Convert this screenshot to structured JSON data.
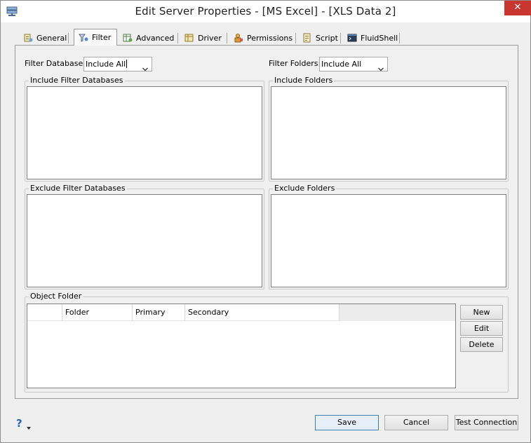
{
  "window": {
    "title": "Edit Server Properties - [MS Excel] - [XLS Data 2]",
    "close_glyph": "✕"
  },
  "tabs": [
    {
      "label": "General",
      "icon": "general-icon"
    },
    {
      "label": "Filter",
      "icon": "filter-icon",
      "active": true
    },
    {
      "label": "Advanced",
      "icon": "advanced-icon"
    },
    {
      "label": "Driver",
      "icon": "driver-icon"
    },
    {
      "label": "Permissions",
      "icon": "permissions-icon"
    },
    {
      "label": "Script",
      "icon": "script-icon"
    },
    {
      "label": "FluidShell",
      "icon": "fluidshell-icon"
    }
  ],
  "filter": {
    "databases_label": "Filter Databases",
    "databases_value": "Include All",
    "folders_label": "Filter Folders:",
    "folders_value": "Include All"
  },
  "groups": {
    "include_databases": "Include Filter Databases",
    "include_folders": "Include Folders",
    "exclude_databases": "Exclude Filter Databases",
    "exclude_folders": "Exclude Folders",
    "object_folder": "Object Folder"
  },
  "object_folder": {
    "columns": [
      "",
      "Folder",
      "Primary",
      "Secondary"
    ],
    "buttons": {
      "new": "New",
      "edit": "Edit",
      "delete": "Delete"
    }
  },
  "footer": {
    "help_glyph": "?",
    "save": "Save",
    "cancel": "Cancel",
    "test_connection": "Test Connection"
  },
  "colors": {
    "close_button": "#c7372f",
    "help_icon": "#2968b0",
    "default_button_border": "#3c7fb1"
  }
}
